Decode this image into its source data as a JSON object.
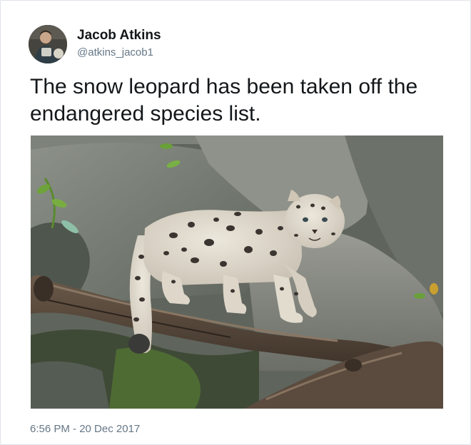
{
  "tweet": {
    "author": {
      "display_name": "Jacob Atkins",
      "handle": "@atkins_jacob1",
      "avatar_icon": "user-avatar"
    },
    "text": "The snow leopard has been taken off the endangered species list.",
    "media": {
      "type": "photo",
      "subject": "snow-leopard-cub"
    },
    "timestamp": "6:56 PM - 20 Dec 2017"
  },
  "colors": {
    "name": "#14171a",
    "secondary_text": "#657786",
    "border": "#dfe3e8"
  }
}
